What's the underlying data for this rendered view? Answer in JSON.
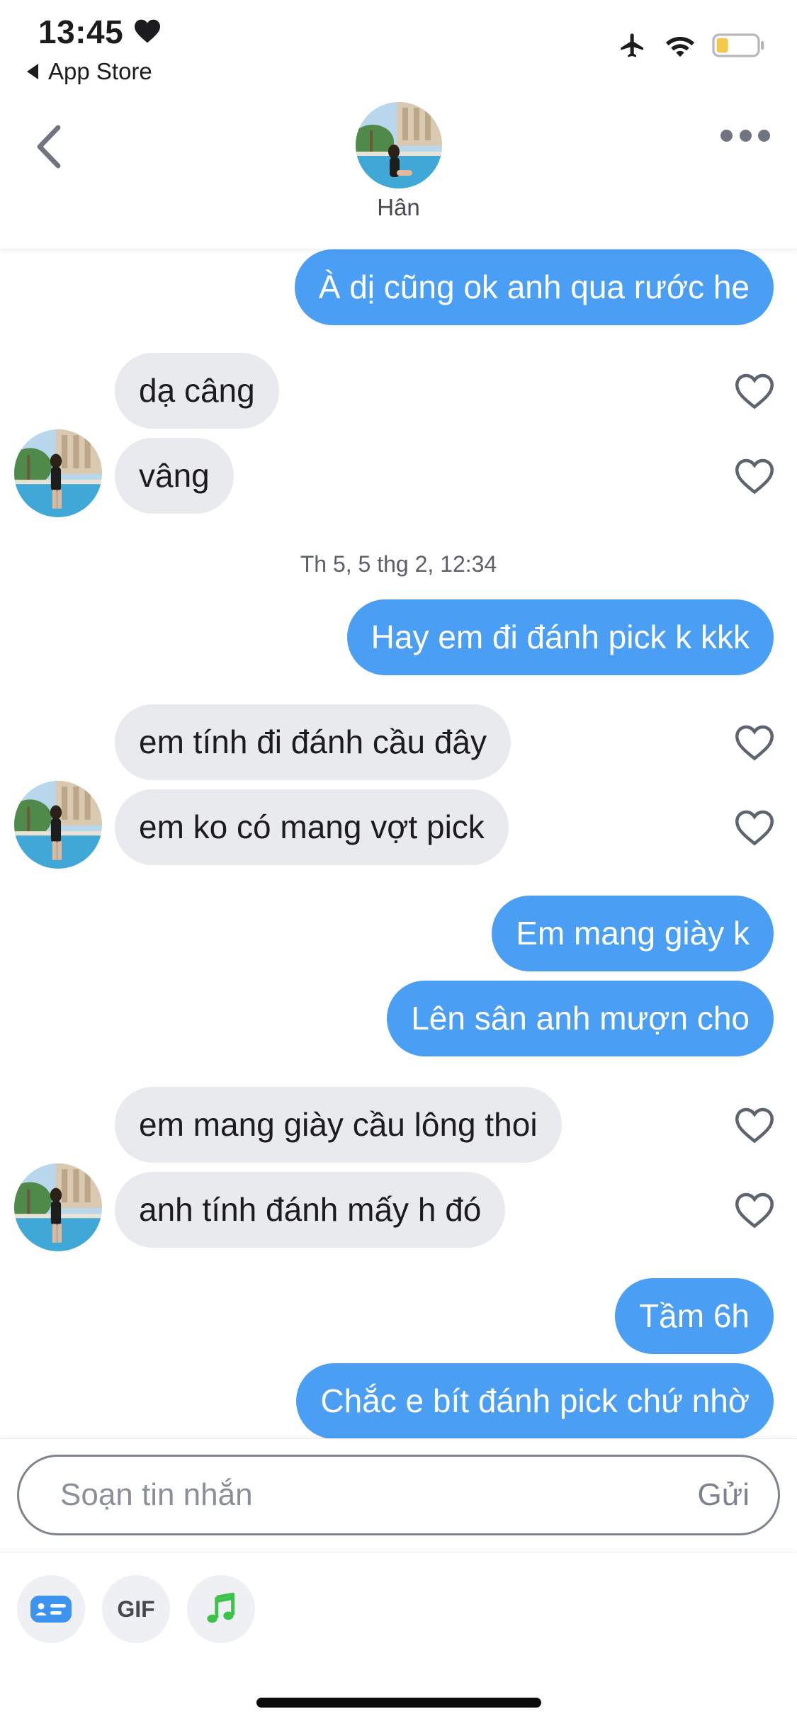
{
  "status_bar": {
    "time": "13:45",
    "back_app": "App Store",
    "icons": [
      "heart-icon",
      "airplane-icon",
      "wifi-icon",
      "battery-icon"
    ]
  },
  "header": {
    "contact_name": "Hân",
    "icons": [
      "back-chevron-icon",
      "more-dots-icon"
    ]
  },
  "messages": [
    {
      "from": "me",
      "text": "À dị cũng ok anh qua rước he"
    },
    {
      "from": "them",
      "text": "dạ câng",
      "liked": false
    },
    {
      "from": "them",
      "text": "vâng",
      "liked": false
    },
    {
      "type": "timestamp",
      "text": "Th 5, 5 thg 2, 12:34"
    },
    {
      "from": "me",
      "text": "Hay em đi đánh pick k kkk"
    },
    {
      "from": "them",
      "text": "em tính đi đánh cầu đây",
      "liked": false
    },
    {
      "from": "them",
      "text": "em ko có mang vợt pick",
      "liked": false
    },
    {
      "from": "me",
      "text": "Em mang giày k"
    },
    {
      "from": "me",
      "text": "Lên sân anh mượn cho"
    },
    {
      "from": "them",
      "text": "em mang giày cầu lông thoi",
      "liked": false
    },
    {
      "from": "them",
      "text": "anh tính đánh mấy h đó",
      "liked": false
    },
    {
      "from": "me",
      "text": "Tầm 6h"
    },
    {
      "from": "me",
      "text": "Chắc e bít đánh pick chứ nhờ"
    }
  ],
  "composer": {
    "placeholder": "Soạn tin nhắn",
    "value": "",
    "send_label": "Gửi"
  },
  "tools": {
    "gif_label": "GIF",
    "icons": [
      "sticker-card-icon",
      "gif-icon",
      "music-note-icon"
    ]
  },
  "colors": {
    "outgoing_bubble": "#4a9ff5",
    "incoming_bubble": "#e9eaee",
    "music_accent": "#3cc24a"
  }
}
